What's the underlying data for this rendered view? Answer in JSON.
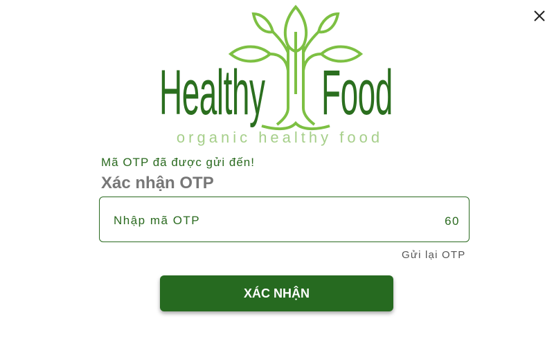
{
  "logo": {
    "word_left": "Healthy",
    "word_right": "Food",
    "tagline": "organic healthy food",
    "dark_green": "#2b6f1f",
    "light_green": "#7dc043"
  },
  "message": {
    "sent": "Mã OTP đã được gửi đến!",
    "title": "Xác nhận OTP"
  },
  "otp_input": {
    "placeholder": "Nhập mã OTP",
    "value": ""
  },
  "countdown": "60",
  "resend_label": "Gửi lại OTP",
  "confirm_label": "XÁC NHẬN",
  "close_icon": "close-icon",
  "colors": {
    "primary": "#266a20",
    "text_green": "#2a6a1f",
    "title_gray": "#777777"
  }
}
